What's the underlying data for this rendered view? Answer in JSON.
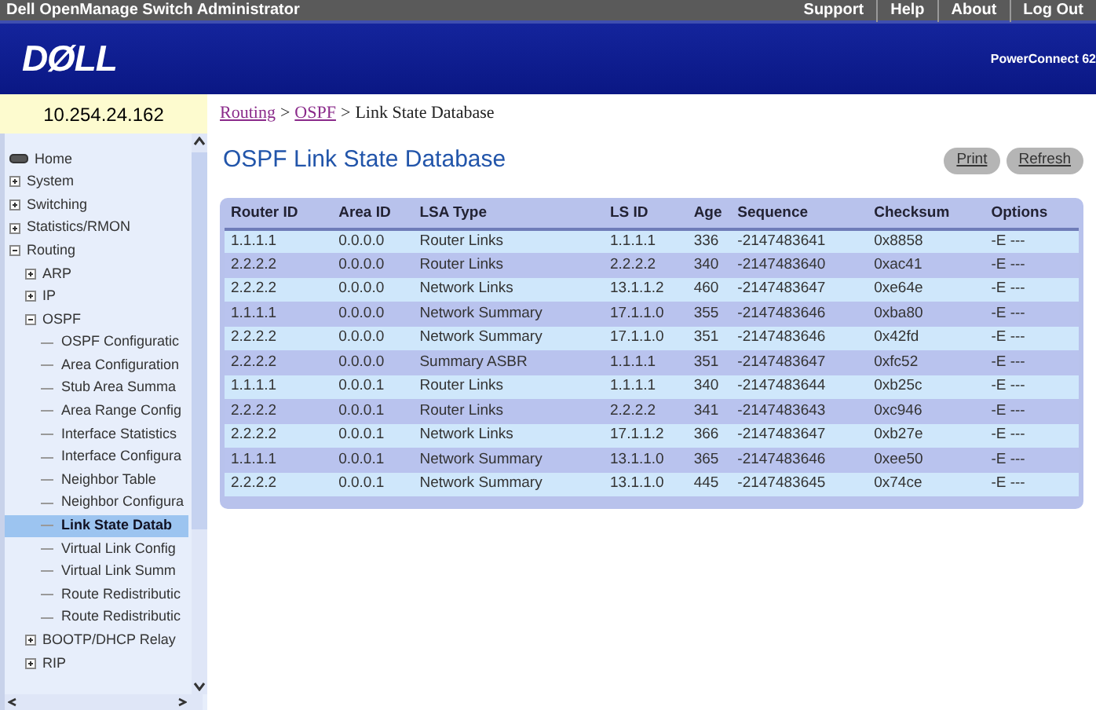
{
  "app_title": "Dell OpenManage Switch Administrator",
  "top_links": [
    "Support",
    "Help",
    "About",
    "Log Out"
  ],
  "banner": {
    "logo": "DØLL",
    "model": "PowerConnect 62"
  },
  "ip_address": "10.254.24.162",
  "breadcrumb": [
    {
      "text": "Routing",
      "kind": "link"
    },
    {
      "text": ">",
      "kind": "separator"
    },
    {
      "text": "OSPF",
      "kind": "link"
    },
    {
      "text": ">",
      "kind": "separator"
    },
    {
      "text": "Link State Database",
      "kind": "current"
    }
  ],
  "tree": [
    {
      "label": "Home",
      "kind": "home",
      "selected": false
    },
    {
      "label": "System",
      "kind": "folder",
      "expanded": false,
      "selected": false
    },
    {
      "label": "Switching",
      "kind": "folder",
      "expanded": false,
      "selected": false
    },
    {
      "label": "Statistics/RMON",
      "kind": "folder",
      "expanded": false,
      "selected": false
    },
    {
      "label": "Routing",
      "kind": "folder",
      "expanded": true,
      "selected": false,
      "children": [
        {
          "label": "ARP",
          "kind": "folder",
          "expanded": false,
          "selected": false
        },
        {
          "label": "IP",
          "kind": "folder",
          "expanded": false,
          "selected": false
        },
        {
          "label": "OSPF",
          "kind": "folder",
          "expanded": true,
          "selected": false,
          "children": [
            {
              "label": "OSPF Configuratic",
              "kind": "page",
              "selected": false
            },
            {
              "label": "Area Configuration",
              "kind": "page",
              "selected": false
            },
            {
              "label": "Stub Area Summa",
              "kind": "page",
              "selected": false
            },
            {
              "label": "Area Range Config",
              "kind": "page",
              "selected": false
            },
            {
              "label": "Interface Statistics",
              "kind": "page",
              "selected": false
            },
            {
              "label": "Interface Configura",
              "kind": "page",
              "selected": false
            },
            {
              "label": "Neighbor Table",
              "kind": "page",
              "selected": false
            },
            {
              "label": "Neighbor Configura",
              "kind": "page",
              "selected": false
            },
            {
              "label": "Link State Datab",
              "kind": "page",
              "selected": true
            },
            {
              "label": "Virtual Link Config",
              "kind": "page",
              "selected": false
            },
            {
              "label": "Virtual Link Summ",
              "kind": "page",
              "selected": false
            },
            {
              "label": "Route Redistributic",
              "kind": "page",
              "selected": false
            },
            {
              "label": "Route Redistributic",
              "kind": "page",
              "selected": false
            }
          ]
        },
        {
          "label": "BOOTP/DHCP Relay",
          "kind": "folder",
          "expanded": false,
          "selected": false
        },
        {
          "label": "RIP",
          "kind": "folder",
          "expanded": false,
          "selected": false
        }
      ]
    }
  ],
  "page_title": "OSPF Link State Database",
  "buttons": [
    "Print",
    "Refresh"
  ],
  "table": {
    "columns": [
      "Router ID",
      "Area ID",
      "LSA Type",
      "LS ID",
      "Age",
      "Sequence",
      "Checksum",
      "Options"
    ],
    "rows": [
      [
        "1.1.1.1",
        "0.0.0.0",
        "Router Links",
        "1.1.1.1",
        "336",
        "-2147483641",
        "0x8858",
        "-E ---"
      ],
      [
        "2.2.2.2",
        "0.0.0.0",
        "Router Links",
        "2.2.2.2",
        "340",
        "-2147483640",
        "0xac41",
        "-E ---"
      ],
      [
        "2.2.2.2",
        "0.0.0.0",
        "Network Links",
        "13.1.1.2",
        "460",
        "-2147483647",
        "0xe64e",
        "-E ---"
      ],
      [
        "1.1.1.1",
        "0.0.0.0",
        "Network Summary",
        "17.1.1.0",
        "355",
        "-2147483646",
        "0xba80",
        "-E ---"
      ],
      [
        "2.2.2.2",
        "0.0.0.0",
        "Network Summary",
        "17.1.1.0",
        "351",
        "-2147483646",
        "0x42fd",
        "-E ---"
      ],
      [
        "2.2.2.2",
        "0.0.0.0",
        "Summary ASBR",
        "1.1.1.1",
        "351",
        "-2147483647",
        "0xfc52",
        "-E ---"
      ],
      [
        "1.1.1.1",
        "0.0.0.1",
        "Router Links",
        "1.1.1.1",
        "340",
        "-2147483644",
        "0xb25c",
        "-E ---"
      ],
      [
        "2.2.2.2",
        "0.0.0.1",
        "Router Links",
        "2.2.2.2",
        "341",
        "-2147483643",
        "0xc946",
        "-E ---"
      ],
      [
        "2.2.2.2",
        "0.0.0.1",
        "Network Links",
        "17.1.1.2",
        "366",
        "-2147483647",
        "0xb27e",
        "-E ---"
      ],
      [
        "1.1.1.1",
        "0.0.0.1",
        "Network Summary",
        "13.1.1.0",
        "365",
        "-2147483646",
        "0xee50",
        "-E ---"
      ],
      [
        "2.2.2.2",
        "0.0.0.1",
        "Network Summary",
        "13.1.1.0",
        "445",
        "-2147483645",
        "0x74ce",
        "-E ---"
      ]
    ]
  }
}
